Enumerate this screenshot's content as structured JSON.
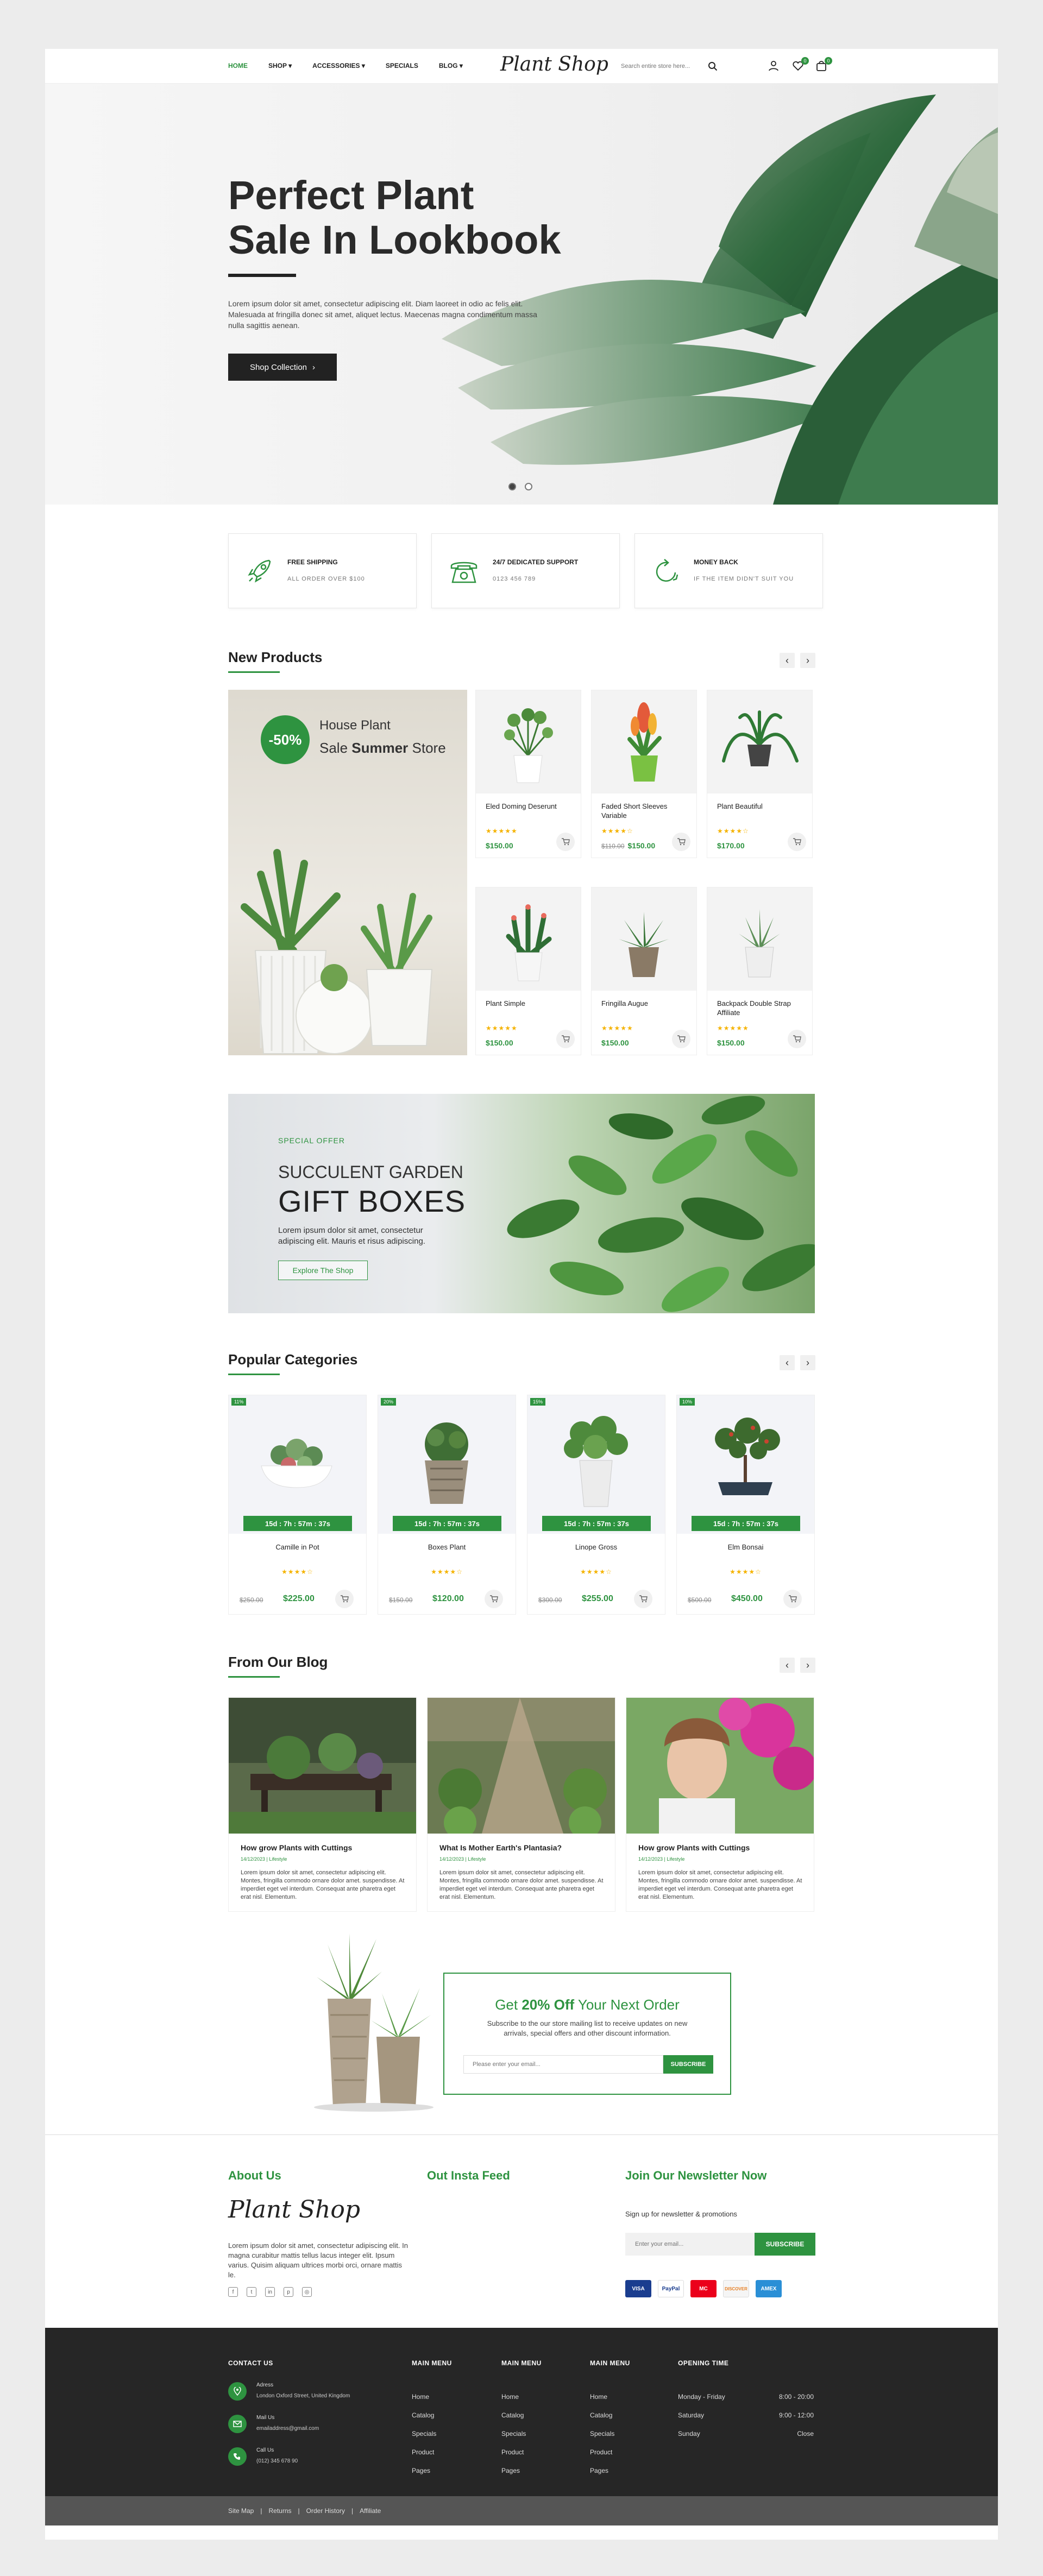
{
  "header": {
    "nav": [
      "HOME",
      "SHOP",
      "ACCESSORIES",
      "SPECIALS",
      "BLOG"
    ],
    "logo": "Plant Shop",
    "search_placeholder": "Search entire store here...",
    "wishlist_count": "0",
    "cart_count": "0",
    "accent": "#2e9340"
  },
  "hero": {
    "title_line1": "Perfect Plant",
    "title_line2": "Sale In Lookbook",
    "text": "Lorem ipsum dolor sit amet, consectetur adipiscing elit. Diam laoreet in odio ac felis elit. Malesuada at fringilla donec sit amet, aliquet lectus. Maecenas magna condimentum massa nulla sagittis aenean.",
    "button": "Shop Collection"
  },
  "features": [
    {
      "icon": "rocket-icon",
      "title": "FREE SHIPPING",
      "sub": "ALL ORDER OVER $100"
    },
    {
      "icon": "phone-icon",
      "title": "24/7 DEDICATED SUPPORT",
      "sub": "0123 456 789"
    },
    {
      "icon": "money-back-icon",
      "title": "MONEY BACK",
      "sub": "IF THE ITEM DIDN'T SUIT YOU"
    }
  ],
  "new_products": {
    "title": "New Products",
    "promo": {
      "discount": "-50%",
      "line1": "House Plant",
      "line2_pre": "Sale ",
      "line2_bold": "Summer",
      "line2_post": " Store"
    },
    "items": [
      {
        "name": "Eled Doming Deserunt",
        "old": "",
        "price": "$150.00"
      },
      {
        "name": "Faded Short Sleeves Variable",
        "old": "$110.00",
        "price": "$150.00"
      },
      {
        "name": "Plant Beautiful",
        "old": "",
        "price": "$170.00"
      },
      {
        "name": "Plant Simple",
        "old": "",
        "price": "$150.00"
      },
      {
        "name": "Fringilla Augue",
        "old": "",
        "price": "$150.00"
      },
      {
        "name": "Backpack Double Strap Affiliate",
        "old": "",
        "price": "$150.00"
      }
    ]
  },
  "gift": {
    "tag": "SPECIAL OFFER",
    "line1": "SUCCULENT GARDEN",
    "line2": "GIFT BOXES",
    "text": "Lorem ipsum dolor sit amet, consectetur adipiscing elit. Mauris et risus adipiscing.",
    "button": "Explore The Shop"
  },
  "categories": {
    "title": "Popular Categories",
    "items": [
      {
        "tag": "11%",
        "countdown": "15d : 7h : 57m : 37s",
        "name": "Camille in Pot",
        "old": "$250.00",
        "price": "$225.00"
      },
      {
        "tag": "20%",
        "countdown": "15d : 7h : 57m : 37s",
        "name": "Boxes Plant",
        "old": "$150.00",
        "price": "$120.00"
      },
      {
        "tag": "15%",
        "countdown": "15d : 7h : 57m : 37s",
        "name": "Linope Gross",
        "old": "$300.00",
        "price": "$255.00"
      },
      {
        "tag": "10%",
        "countdown": "15d : 7h : 57m : 37s",
        "name": "Elm Bonsai",
        "old": "$500.00",
        "price": "$450.00"
      }
    ]
  },
  "blog": {
    "title": "From Our Blog",
    "posts": [
      {
        "title": "How grow Plants with Cuttings",
        "meta": "14/12/2023 | Lifestyle",
        "text": "Lorem ipsum dolor sit amet, consectetur adipiscing elit. Montes, fringilla commodo ornare dolor amet. suspendisse. At imperdiet eget vel interdum. Consequat ante pharetra eget erat nisl. Elementum."
      },
      {
        "title": "What Is Mother Earth's Plantasia?",
        "meta": "14/12/2023 | Lifestyle",
        "text": "Lorem ipsum dolor sit amet, consectetur adipiscing elit. Montes, fringilla commodo ornare dolor amet. suspendisse. At imperdiet eget vel interdum. Consequat ante pharetra eget erat nisl. Elementum."
      },
      {
        "title": "How grow Plants with Cuttings",
        "meta": "14/12/2023 | Lifestyle",
        "text": "Lorem ipsum dolor sit amet, consectetur adipiscing elit. Montes, fringilla commodo ornare dolor amet. suspendisse. At imperdiet eget vel interdum. Consequat ante pharetra eget erat nisl. Elementum."
      }
    ]
  },
  "newsletter_box": {
    "pre": "Get ",
    "bold": "20% Off",
    "post": " Your Next Order",
    "text": "Subscribe to the our store mailing list to receive updates on new arrivals, special offers and other discount information.",
    "placeholder": "Please enter your email...",
    "button": "SUBSCRIBE"
  },
  "footer": {
    "about_title": "About Us",
    "insta_title": "Out Insta Feed",
    "news_title": "Join Our Newsletter Now",
    "logo": "Plant Shop",
    "about_text": "Lorem ipsum dolor sit amet, consectetur adipiscing elit. In magna curabitur mattis tellus lacus integer elit. Ipsum varius. Quisim aliquam ultrices morbi orci, ornare mattis le.",
    "signup": "Sign up for newsletter & promotions",
    "email_placeholder": "Enter your email...",
    "subscribe": "SUBSCRIBE",
    "payments": [
      "VISA",
      "PayPal",
      "MC",
      "DISCOVER",
      "AMEX"
    ],
    "contact_title": "CONTACT US",
    "contacts": [
      {
        "icon": "location-icon",
        "label": "Adress",
        "value": "London Oxford Street, United Kingdom"
      },
      {
        "icon": "mail-icon",
        "label": "Mail Us",
        "value": "emailaddress@gmail.com"
      },
      {
        "icon": "call-icon",
        "label": "Call Us",
        "value": "(012) 345 678 90"
      }
    ],
    "menus": [
      {
        "title": "MAIN MENU",
        "items": [
          "Home",
          "Catalog",
          "Specials",
          "Product",
          "Pages"
        ]
      },
      {
        "title": "MAIN MENU",
        "items": [
          "Home",
          "Catalog",
          "Specials",
          "Product",
          "Pages"
        ]
      },
      {
        "title": "MAIN MENU",
        "items": [
          "Home",
          "Catalog",
          "Specials",
          "Product",
          "Pages"
        ]
      }
    ],
    "hours_title": "OPENING TIME",
    "hours": [
      {
        "day": "Monday - Friday",
        "time": "8:00 - 20:00"
      },
      {
        "day": "Saturday",
        "time": "9:00 - 12:00"
      },
      {
        "day": "Sunday",
        "time": "Close"
      }
    ],
    "bottom_links": [
      "Site Map",
      "Returns",
      "Order History",
      "Affiliate"
    ]
  }
}
